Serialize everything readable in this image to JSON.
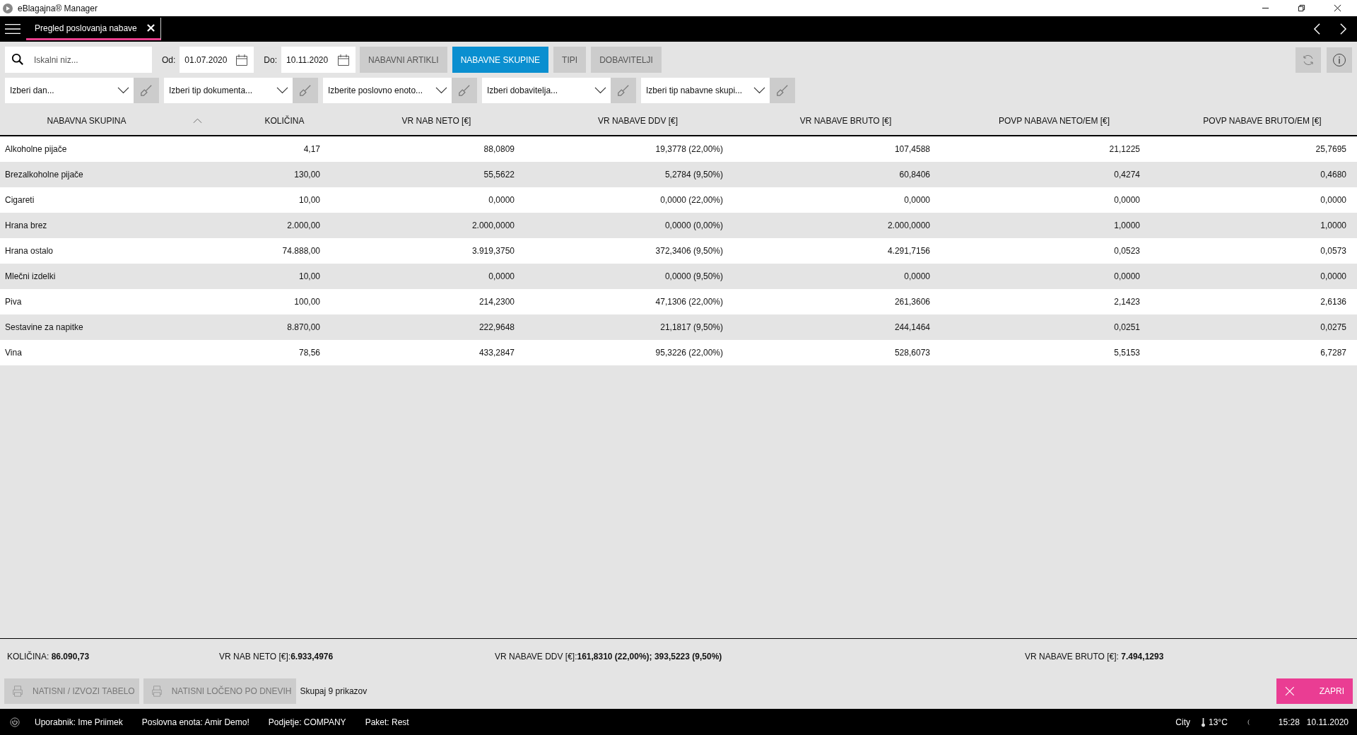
{
  "window": {
    "title": "eBlagajna® Manager"
  },
  "tab": {
    "label": "Pregled poslovanja nabave"
  },
  "search": {
    "placeholder": "Iskalni niz..."
  },
  "date_from": {
    "label": "Od:",
    "value": "01.07.2020"
  },
  "date_to": {
    "label": "Do:",
    "value": "10.11.2020"
  },
  "view_tabs": [
    {
      "label": "NABAVNI ARTIKLI",
      "selected": false
    },
    {
      "label": "NABAVNE SKUPINE",
      "selected": true
    },
    {
      "label": "TIPI",
      "selected": false
    },
    {
      "label": "DOBAVITELJI",
      "selected": false
    }
  ],
  "filters": [
    {
      "placeholder": "Izberi dan..."
    },
    {
      "placeholder": "Izberi tip dokumenta..."
    },
    {
      "placeholder": "Izberite poslovno enoto..."
    },
    {
      "placeholder": "Izberi dobavitelja..."
    },
    {
      "placeholder": "Izberi tip nabavne skupi..."
    }
  ],
  "table": {
    "columns": [
      "NABAVNA SKUPINA",
      "KOLIČINA",
      "VR NAB NETO [€]",
      "VR NABAVE DDV [€]",
      "VR NABAVE BRUTO [€]",
      "POVP NABAVA NETO/EM [€]",
      "POVP NABAVE BRUTO/EM [€]"
    ],
    "rows": [
      [
        "Alkoholne pijače",
        "4,17",
        "88,0809",
        "19,3778 (22,00%)",
        "107,4588",
        "21,1225",
        "25,7695"
      ],
      [
        "Brezalkoholne pijače",
        "130,00",
        "55,5622",
        "5,2784 (9,50%)",
        "60,8406",
        "0,4274",
        "0,4680"
      ],
      [
        "Cigareti",
        "10,00",
        "0,0000",
        "0,0000 (22,00%)",
        "0,0000",
        "0,0000",
        "0,0000"
      ],
      [
        "Hrana brez",
        "2.000,00",
        "2.000,0000",
        "0,0000 (0,00%)",
        "2.000,0000",
        "1,0000",
        "1,0000"
      ],
      [
        "Hrana ostalo",
        "74.888,00",
        "3.919,3750",
        "372,3406 (9,50%)",
        "4.291,7156",
        "0,0523",
        "0,0573"
      ],
      [
        "Mlečni izdelki",
        "10,00",
        "0,0000",
        "0,0000 (9,50%)",
        "0,0000",
        "0,0000",
        "0,0000"
      ],
      [
        "Piva",
        "100,00",
        "214,2300",
        "47,1306 (22,00%)",
        "261,3606",
        "2,1423",
        "2,6136"
      ],
      [
        "Sestavine za napitke",
        "8.870,00",
        "222,9648",
        "21,1817 (9,50%)",
        "244,1464",
        "0,0251",
        "0,0275"
      ],
      [
        "Vina",
        "78,56",
        "433,2847",
        "95,3226 (22,00%)",
        "528,6073",
        "5,5153",
        "6,7287"
      ]
    ]
  },
  "totals": [
    "KOLIČINA: **86.090,73**",
    "VR NAB NETO [€]:**6.933,4976**",
    "VR NABAVE DDV [€]:**161,8310 (22,00%); 393,5223 (9,50%)**",
    "VR NABAVE BRUTO [€]: **7.494,1293**"
  ],
  "actions": [
    "NATISNI / IZVOZI TABELO",
    "NATISNI LOČENO PO DNEVIH"
  ],
  "count": "Skupaj 9 prikazov",
  "close_button": "ZAPRI",
  "status_bar": {
    "user": "Uporabnik: Ime Priimek",
    "unit": "Poslovna enota: Amir Demo!",
    "company": "Podjetje: COMPANY",
    "package": "Paket: Rest",
    "city": "City",
    "temperature": "13°C",
    "time": "15:28",
    "date": "10.11.2020"
  }
}
